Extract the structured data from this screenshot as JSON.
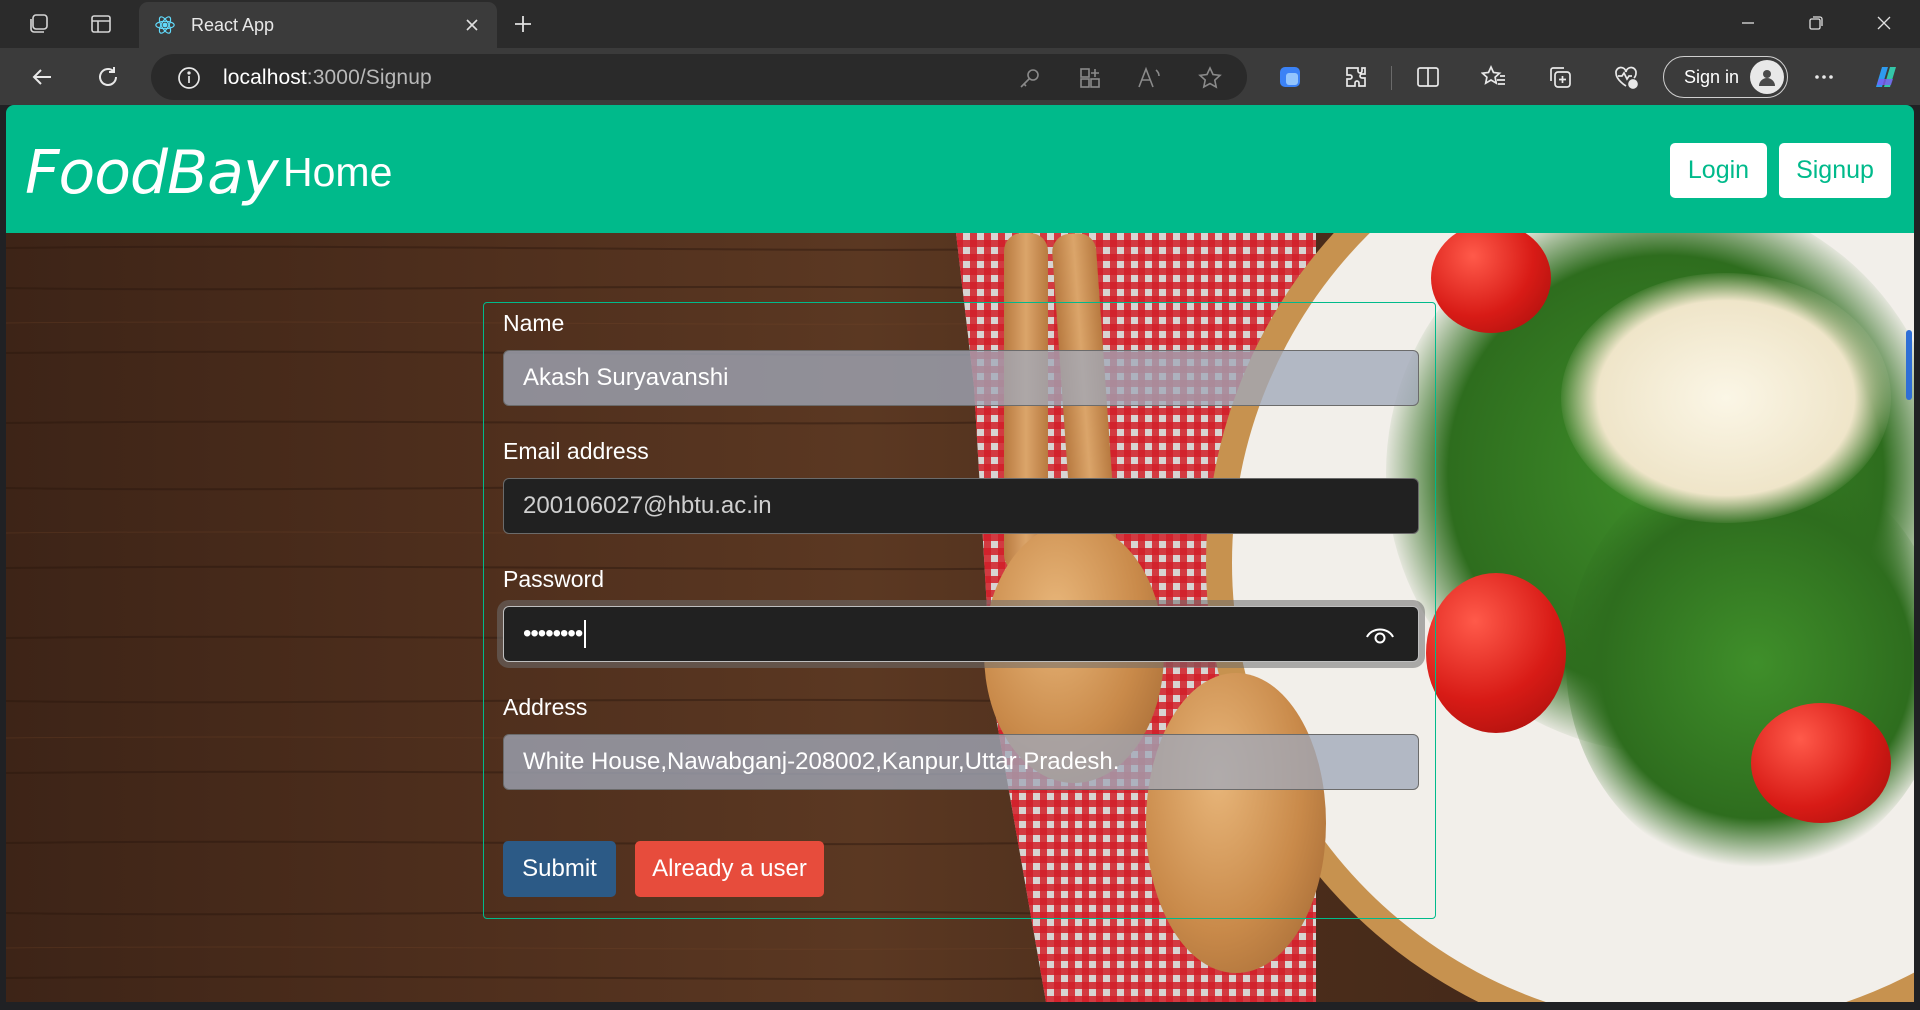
{
  "browser": {
    "tab_title": "React App",
    "url_host": "localhost",
    "url_path": ":3000/Signup",
    "signin_label": "Sign in"
  },
  "navbar": {
    "brand": "FoodBay",
    "home": "Home",
    "login": "Login",
    "signup": "Signup"
  },
  "form": {
    "name_label": "Name",
    "name_value": "Akash Suryavanshi",
    "email_label": "Email address",
    "email_value": "200106027@hbtu.ac.in",
    "password_label": "Password",
    "password_value": "••••••••",
    "address_label": "Address",
    "address_value": "White House,Nawabganj-208002,Kanpur,Uttar Pradesh.",
    "submit_label": "Submit",
    "already_user_label": "Already a user"
  },
  "colors": {
    "accent": "#00ba8b",
    "submit": "#2c5a86",
    "danger": "#e74c3c"
  },
  "icons": [
    "workspaces-icon",
    "tab-actions-icon",
    "react-icon",
    "close-icon",
    "plus-icon",
    "minimize-icon",
    "restore-icon",
    "back-icon",
    "refresh-icon",
    "info-icon",
    "key-icon",
    "apps-icon",
    "read-aloud-icon",
    "favorite-star-icon",
    "extension-icon",
    "puzzle-icon",
    "split-screen-icon",
    "favorites-icon",
    "collections-icon",
    "browser-essentials-icon",
    "more-icon",
    "copilot-icon",
    "eye-icon"
  ]
}
